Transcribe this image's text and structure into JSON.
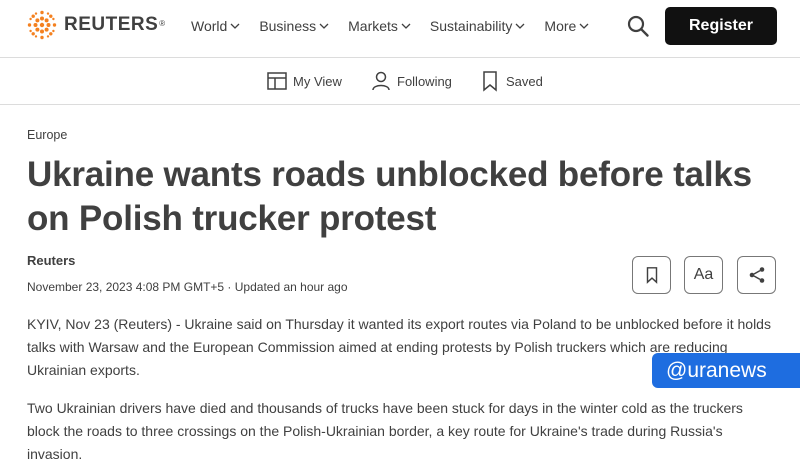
{
  "header": {
    "logo_text": "REUTERS",
    "logo_reg": "®",
    "nav": [
      {
        "label": "World"
      },
      {
        "label": "Business"
      },
      {
        "label": "Markets"
      },
      {
        "label": "Sustainability"
      },
      {
        "label": "More"
      }
    ],
    "register_label": "Register",
    "icons": {
      "search": "search-icon",
      "chevron": "chevron-down-icon"
    },
    "brand_accent": "#f48120"
  },
  "subnav": {
    "my_view": "My View",
    "following": "Following",
    "saved": "Saved"
  },
  "article": {
    "section": "Europe",
    "headline_line1": "Ukraine wants roads unblocked before talks",
    "headline_line2": "on Polish trucker protest",
    "byline": "Reuters",
    "dateline": "November 23, 2023 4:08 PM GMT+5 · Updated an hour ago",
    "actions": {
      "text_size_label": "Aa"
    },
    "paragraphs": [
      "KYIV, Nov 23 (Reuters) - Ukraine said on Thursday it wanted its export routes via Poland to be unblocked before it holds talks with Warsaw and the European Commission aimed at ending protests by Polish truckers which are reducing Ukrainian exports.",
      "Two Ukrainian drivers have died and thousands of trucks have been stuck for days in the winter cold as the truckers block the roads to three crossings on the Polish-Ukrainian border, a key route for Ukraine's trade during Russia's invasion."
    ]
  },
  "watermark": {
    "text": "@uranews",
    "color": "#1e6de0"
  }
}
